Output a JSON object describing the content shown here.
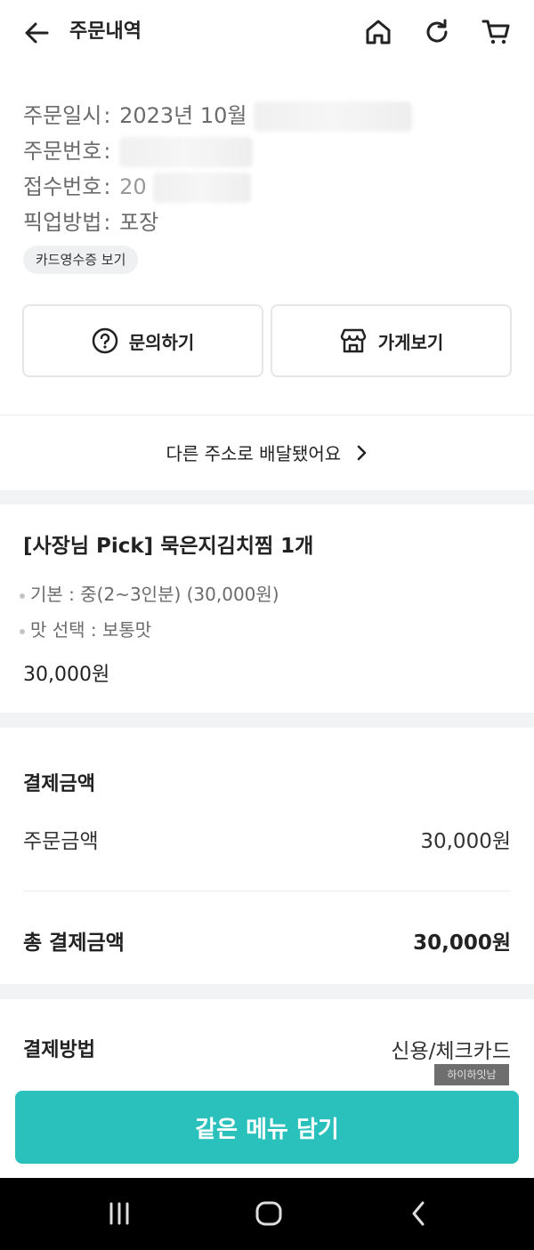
{
  "header": {
    "title": "주문내역",
    "icons": [
      "back-arrow-icon",
      "home-icon",
      "refresh-icon",
      "cart-icon"
    ]
  },
  "order_info": {
    "datetime_label": "주문일시",
    "datetime_value": "2023년 10월",
    "order_no_label": "주문번호",
    "receipt_no_label": "접수번호",
    "receipt_no_partial": "20",
    "pickup_label": "픽업방법",
    "pickup_value": "포장",
    "separator": ":"
  },
  "receipt_chip": "카드영수증 보기",
  "actions": {
    "inquiry_label": "문의하기",
    "store_label": "가게보기"
  },
  "address_link": "다른 주소로 배달됐어요",
  "menu": {
    "title": "[사장님 Pick] 묵은지김치찜 1개",
    "options": [
      "기본 : 중(2~3인분) (30,000원)",
      "맛 선택 : 보통맛"
    ],
    "price": "30,000원"
  },
  "payment": {
    "section_title": "결제금액",
    "order_amount_label": "주문금액",
    "order_amount_value": "30,000원",
    "total_label": "총 결제금액",
    "total_value": "30,000원"
  },
  "payment_method": {
    "label": "결제방법",
    "value": "신용/체크카드"
  },
  "watermark": "하이하잇남",
  "cta_label": "같은 메뉴 담기",
  "colors": {
    "accent": "#2ac1bc",
    "chip_bg": "#eef0f1",
    "section_gap": "#f2f3f5"
  }
}
